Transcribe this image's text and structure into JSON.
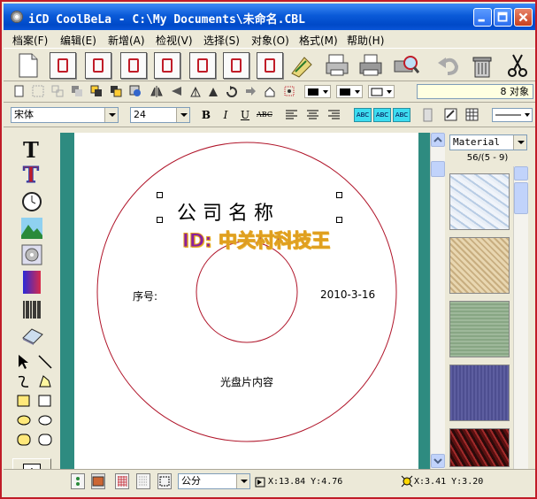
{
  "window": {
    "title": "iCD CoolBeLa - C:\\My Documents\\未命名.CBL",
    "accent": "#0a5ad8",
    "frame_color": "#c01c28"
  },
  "menu": {
    "items": [
      "档案(F)",
      "编辑(E)",
      "新增(A)",
      "检视(V)",
      "选择(S)",
      "对象(O)",
      "格式(M)",
      "帮助(H)"
    ]
  },
  "toolbar_big": {
    "buttons": [
      "new-page-icon",
      "disc-label-icon",
      "cd-cover-front-icon",
      "cd-cover-back-icon",
      "dvd-cover-icon",
      "jewel-case-icon",
      "spine-label-icon",
      "zip-label-icon",
      "wand-icon",
      "printer-setup-icon",
      "print-icon",
      "print-preview-icon",
      "undo-icon",
      "trash-icon",
      "scissors-icon"
    ]
  },
  "toolbar_draw": {
    "object_count": "8 对象"
  },
  "toolbar_font": {
    "font_name": "宋体",
    "font_size": "24",
    "bold": "B",
    "italic": "I",
    "underline": "U",
    "strike": "ABC",
    "abc_label": "ABC"
  },
  "left_tools": {
    "text_mode": "A"
  },
  "canvas": {
    "disc_title": "公 司 名 称",
    "watermark": "ID: 中关村科技王",
    "serial_label": "序号:",
    "date": "2010-3-16",
    "content_label": "光盘片内容"
  },
  "material": {
    "selected": "Material",
    "count": "56/(5 - 9)"
  },
  "status": {
    "unit": "公分",
    "pos_label": "X:13.84 Y:4.76",
    "size_label": "X:3.41 Y:3.20"
  }
}
